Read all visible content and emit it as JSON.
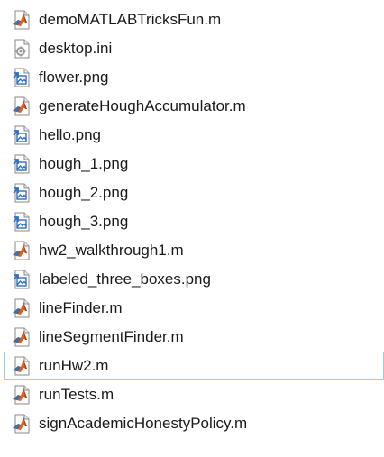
{
  "files": [
    {
      "name": "demoMATLABTricksFun.m",
      "icon": "matlab-file-icon"
    },
    {
      "name": "desktop.ini",
      "icon": "settings-file-icon"
    },
    {
      "name": "flower.png",
      "icon": "image-file-icon"
    },
    {
      "name": "generateHoughAccumulator.m",
      "icon": "matlab-file-icon"
    },
    {
      "name": "hello.png",
      "icon": "image-file-icon"
    },
    {
      "name": "hough_1.png",
      "icon": "image-file-icon"
    },
    {
      "name": "hough_2.png",
      "icon": "image-file-icon"
    },
    {
      "name": "hough_3.png",
      "icon": "image-file-icon"
    },
    {
      "name": "hw2_walkthrough1.m",
      "icon": "matlab-file-icon"
    },
    {
      "name": "labeled_three_boxes.png",
      "icon": "image-file-icon"
    },
    {
      "name": "lineFinder.m",
      "icon": "matlab-file-icon"
    },
    {
      "name": "lineSegmentFinder.m",
      "icon": "matlab-file-icon"
    },
    {
      "name": "runHw2.m",
      "icon": "matlab-file-icon",
      "selected": true
    },
    {
      "name": "runTests.m",
      "icon": "matlab-file-icon"
    },
    {
      "name": "signAcademicHonestyPolicy.m",
      "icon": "matlab-file-icon"
    }
  ],
  "colors": {
    "selection_border": "#99c9ef",
    "matlab_orange": "#e0601a",
    "matlab_blue": "#3a6fb0",
    "image_blue": "#2f6fc2"
  }
}
